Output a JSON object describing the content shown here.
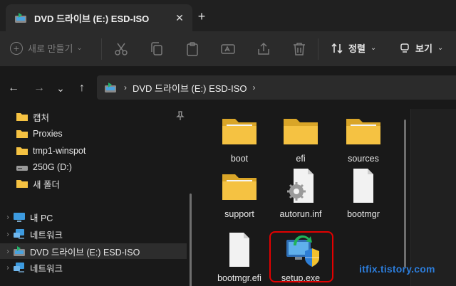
{
  "tab": {
    "title": "DVD 드라이브 (E:) ESD-ISO",
    "close": "✕",
    "new_tab": "+"
  },
  "toolbar": {
    "new_label": "새로 만들기",
    "sort_label": "정렬",
    "view_label": "보기",
    "icons": [
      "cut-icon",
      "copy-icon",
      "paste-icon",
      "rename-icon",
      "share-icon",
      "delete-icon"
    ]
  },
  "address": {
    "back": "←",
    "forward": "→",
    "recent": "⌄",
    "up": "↑",
    "path": "DVD 드라이브 (E:) ESD-ISO"
  },
  "sidebar": {
    "items": [
      {
        "label": "캡처",
        "icon": "folder-icon",
        "pinned": true
      },
      {
        "label": "Proxies",
        "icon": "folder-icon"
      },
      {
        "label": "tmp1-winspot",
        "icon": "folder-icon"
      },
      {
        "label": "250G (D:)",
        "icon": "drive-icon"
      },
      {
        "label": "새 폴더",
        "icon": "folder-icon"
      },
      {
        "label": "내 PC",
        "icon": "pc-icon"
      },
      {
        "label": "네트워크",
        "icon": "network-icon"
      },
      {
        "label": "DVD 드라이브 (E:) ESD-ISO",
        "icon": "dvd-icon",
        "selected": true
      },
      {
        "label": "네트워크",
        "icon": "network-icon"
      }
    ]
  },
  "files": [
    {
      "name": "boot",
      "type": "folder"
    },
    {
      "name": "efi",
      "type": "folder"
    },
    {
      "name": "sources",
      "type": "folder"
    },
    {
      "name": "support",
      "type": "folder"
    },
    {
      "name": "autorun.inf",
      "type": "settings-file"
    },
    {
      "name": "bootmgr",
      "type": "file"
    },
    {
      "name": "bootmgr.efi",
      "type": "file"
    },
    {
      "name": "setup.exe",
      "type": "setup-exe",
      "highlighted": true
    }
  ],
  "watermark": "itfix.tistory.com",
  "colors": {
    "folder": "#f5c242",
    "highlight": "#e30000",
    "accent": "#2c7ddb"
  }
}
